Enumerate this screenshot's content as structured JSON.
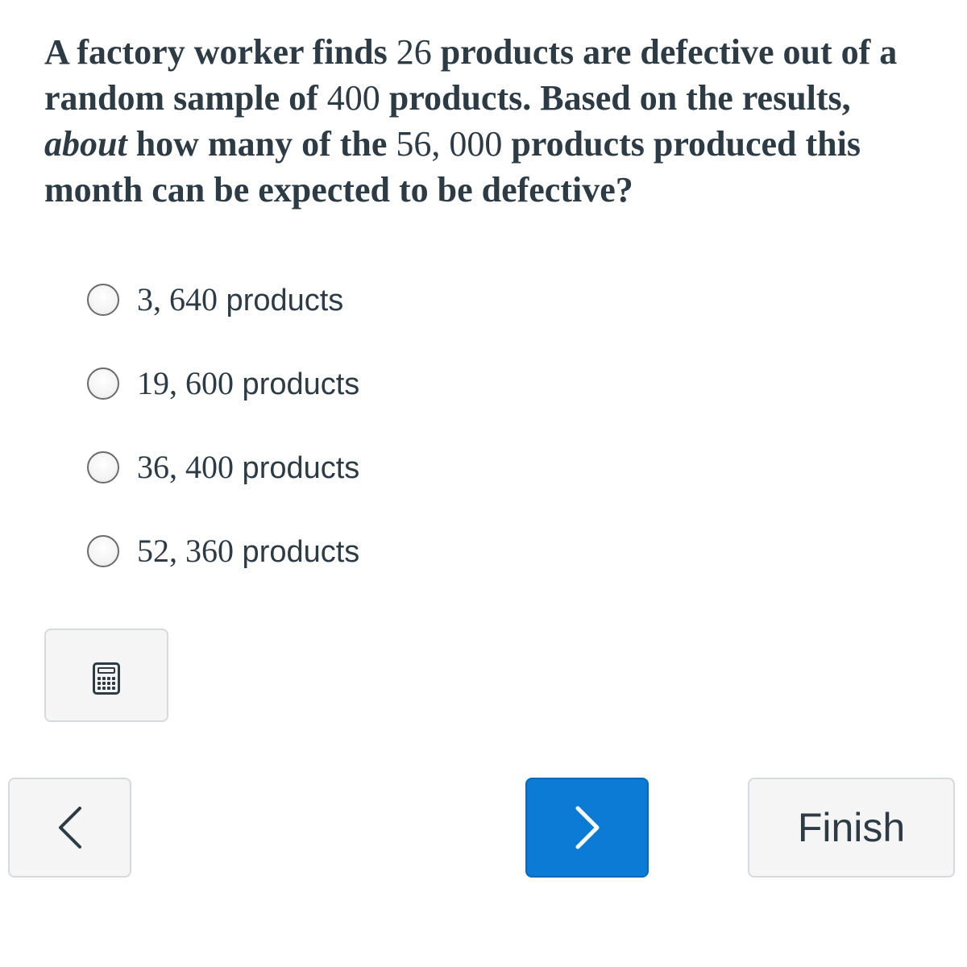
{
  "question": {
    "part1": "A factory worker finds ",
    "n1": "26",
    "part2": " products are defective out of a random sample of ",
    "n2": "400",
    "part3": " products. Based on the results, ",
    "emphasis": "about",
    "part4": " how many of the ",
    "n3": "56, 000",
    "part5": " products produced this month can be expected to be defective?"
  },
  "choices": [
    {
      "value": "3, 640",
      "unit": " products"
    },
    {
      "value": "19, 600",
      "unit": " products"
    },
    {
      "value": "36, 400",
      "unit": " products"
    },
    {
      "value": "52, 360",
      "unit": " products"
    }
  ],
  "icons": {
    "calculator": "calculator-icon",
    "previous": "chevron-left-icon",
    "next": "chevron-right-icon"
  },
  "colors": {
    "primary": "#0b7bd6",
    "text": "#2d3b45",
    "button_bg": "#f5f5f5",
    "button_border": "#d7dadd"
  },
  "navigation": {
    "finish_label": "Finish"
  }
}
